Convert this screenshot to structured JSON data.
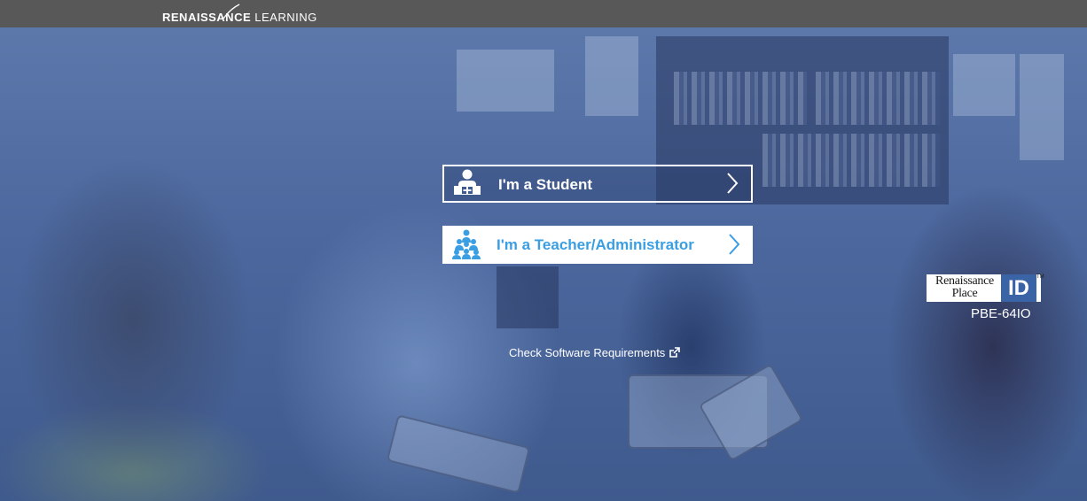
{
  "header": {
    "logo_bold": "RENAISSANCE",
    "logo_light": "LEARNING"
  },
  "main": {
    "student_button": {
      "label": "I'm a Student",
      "icon": "student-icon"
    },
    "teacher_button": {
      "label": "I'm a Teacher/Administrator",
      "icon": "teacher-group-icon"
    },
    "requirements_link": {
      "label": "Check Software Requirements",
      "icon": "external-link-icon"
    }
  },
  "renaissance_place_id": {
    "badge_line1": "Renaissance",
    "badge_line2": "Place",
    "badge_id": "ID",
    "badge_tm": "TM",
    "code": "PBE-64IO"
  },
  "colors": {
    "topbar": "#585858",
    "accent": "#3a9ee3",
    "overlay": "#4b679d",
    "id_blue": "#3a64a6"
  }
}
